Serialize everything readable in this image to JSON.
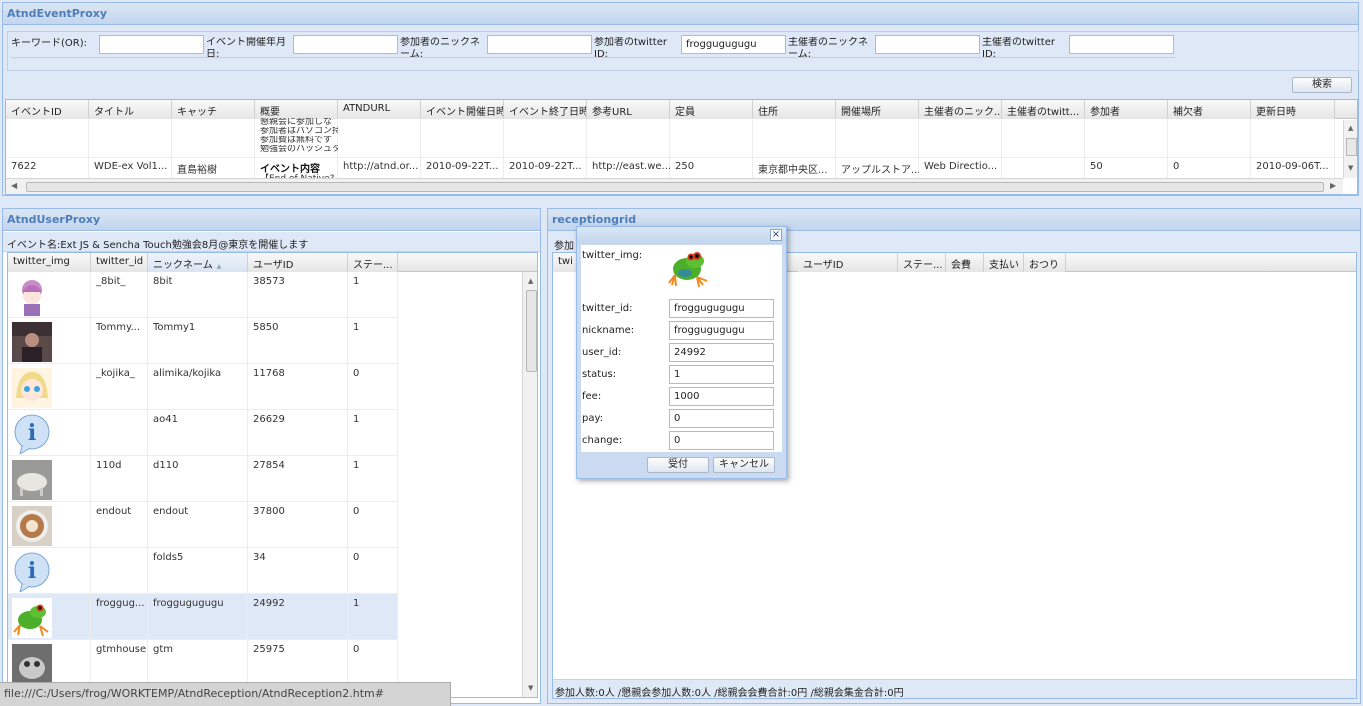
{
  "event_panel": {
    "title": "AtndEventProxy",
    "form": {
      "keyword_label": "キーワード(OR):",
      "keyword_value": "",
      "ym_label": "イベント開催年月日:",
      "ym_value": "",
      "participant_nick_label": "参加者のニックネーム:",
      "participant_nick_value": "",
      "participant_twitter_label": "参加者のtwitter ID:",
      "participant_twitter_value": "froggugugugu",
      "owner_nick_label": "主催者のニックネーム:",
      "owner_nick_value": "",
      "owner_twitter_label": "主催者のtwitter ID:",
      "owner_twitter_value": ""
    },
    "search_button": "検索",
    "columns": [
      "イベントID",
      "タイトル",
      "キャッチ",
      "概要",
      "ATNDURL",
      "イベント開催日時",
      "イベント終了日時",
      "参考URL",
      "定員",
      "住所",
      "開催場所",
      "主催者のニック...",
      "主催者のtwitt...",
      "参加者",
      "補欠者",
      "更新日時"
    ],
    "prev_row_summary": [
      "懇親会に参加しな",
      "参加者はパソコン持",
      "参加費は無料です",
      "勉強会のハッシュタ"
    ],
    "row": {
      "event_id": "7622",
      "title": "WDE-ex Vol1...",
      "catch": "直島裕樹",
      "summary_bold": "イベント内容",
      "summary_sub": "【End of Native?",
      "atnd_url": "http://atnd.or...",
      "start": "2010-09-22T...",
      "end": "2010-09-22T...",
      "ref_url": "http://east.we...",
      "limit": "250",
      "address": "東京都中央区...",
      "place": "アップルストア...",
      "owner_nick": "Web Directio...",
      "owner_twitter": "",
      "accepted": "50",
      "waiting": "0",
      "updated": "2010-09-06T..."
    }
  },
  "user_panel": {
    "title": "AtndUserProxy",
    "event_name": "イベント名:Ext JS & Sencha Touch勉強会8月@東京を開催します",
    "columns": [
      "twitter_img",
      "twitter_id",
      "ニックネーム",
      "ユーザID",
      "ステー..."
    ],
    "sort_indicator": "▲",
    "rows": [
      {
        "twitter_id": "_8bit_",
        "nickname": "8bit",
        "user_id": "38573",
        "status": "1",
        "avatar": "anime-girl-purple"
      },
      {
        "twitter_id": "Tommy...",
        "nickname": "Tommy1",
        "user_id": "5850",
        "status": "1",
        "avatar": "dark-photo"
      },
      {
        "twitter_id": "_kojika_",
        "nickname": "alimika/kojika",
        "user_id": "11768",
        "status": "0",
        "avatar": "anime-girl-blonde"
      },
      {
        "twitter_id": "",
        "nickname": "ao41",
        "user_id": "26629",
        "status": "1",
        "avatar": "info-icon"
      },
      {
        "twitter_id": "110d",
        "nickname": "d110",
        "user_id": "27854",
        "status": "1",
        "avatar": "gray-object"
      },
      {
        "twitter_id": "endout",
        "nickname": "endout",
        "user_id": "37800",
        "status": "0",
        "avatar": "latte-art"
      },
      {
        "twitter_id": "",
        "nickname": "folds5",
        "user_id": "34",
        "status": "0",
        "avatar": "info-icon"
      },
      {
        "twitter_id": "froggug...",
        "nickname": "froggugugugu",
        "user_id": "24992",
        "status": "1",
        "avatar": "frog"
      },
      {
        "twitter_id": "gtmhouse",
        "nickname": "gtm",
        "user_id": "25975",
        "status": "0",
        "avatar": "gray-animal"
      }
    ]
  },
  "reception_panel": {
    "title": "receptiongrid",
    "toolbar_label": "参加",
    "columns_partial": [
      "twi"
    ],
    "columns": [
      "ユーザID",
      "ステー...",
      "会費",
      "支払い",
      "おつり"
    ],
    "footer": "参加人数:0人 /懇親会参加人数:0人 /総親会会費合計:0円 /総親会集金合計:0円"
  },
  "dialog": {
    "close_symbol": "×",
    "img_label": "twitter_img:",
    "fields": [
      {
        "label": "twitter_id:",
        "value": "froggugugugu"
      },
      {
        "label": "nickname:",
        "value": "froggugugugu"
      },
      {
        "label": "user_id:",
        "value": "24992"
      },
      {
        "label": "status:",
        "value": "1"
      },
      {
        "label": "fee:",
        "value": "1000"
      },
      {
        "label": "pay:",
        "value": "0"
      },
      {
        "label": "change:",
        "value": "0"
      }
    ],
    "ok_button": "受付",
    "cancel_button": "キャンセル"
  },
  "status_bar": "file:///C:/Users/frog/WORKTEMP/AtndReception/AtndReception2.htm#"
}
